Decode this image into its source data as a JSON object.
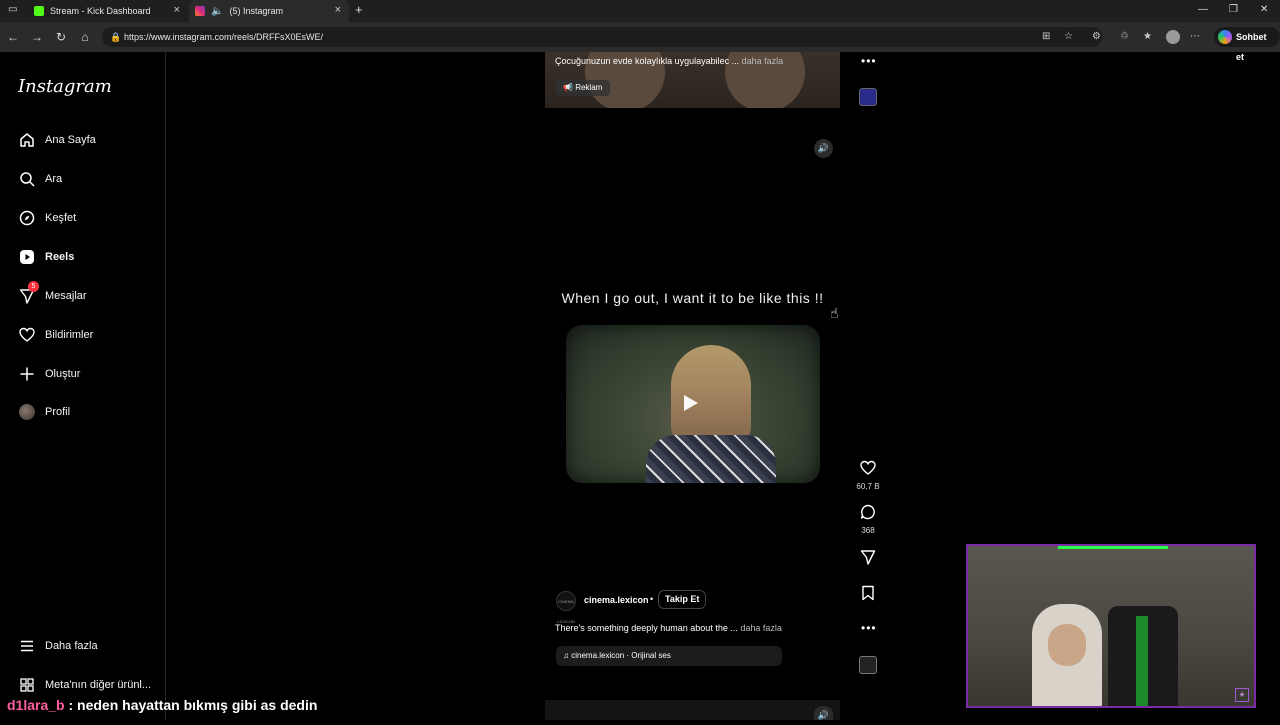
{
  "browser": {
    "tabs": [
      {
        "title": "Stream - Kick Dashboard",
        "icon": "kick-icon",
        "color": "#53fc18"
      },
      {
        "title": "(5) Instagram",
        "icon": "instagram-icon",
        "color": "#e1306c"
      }
    ],
    "new_tab": "+",
    "url": "https://www.instagram.com/reels/DRFFsX0EsWE/",
    "copilot_label": "Sohbet et"
  },
  "sidebar": {
    "logo": "Instagram",
    "items": [
      {
        "label": "Ana Sayfa",
        "icon": "home-icon"
      },
      {
        "label": "Ara",
        "icon": "search-icon"
      },
      {
        "label": "Keşfet",
        "icon": "compass-icon"
      },
      {
        "label": "Reels",
        "icon": "reels-icon",
        "active": true
      },
      {
        "label": "Mesajlar",
        "icon": "messenger-icon",
        "badge": "5"
      },
      {
        "label": "Bildirimler",
        "icon": "heart-icon"
      },
      {
        "label": "Oluştur",
        "icon": "plus-icon"
      },
      {
        "label": "Profil",
        "icon": "avatar"
      }
    ],
    "more": "Daha fazla",
    "meta": "Meta'nın diğer ürünl..."
  },
  "top_reel": {
    "caption": "Çocuğunuzun evde kolaylıkla uygulayabilec ...",
    "more": "daha fazla",
    "ad_label": "Reklam"
  },
  "reel": {
    "overlay_text": "When I go out, I want it to be like this !!",
    "likes": "60,7 B",
    "comments": "368",
    "username": "cinema.lexicon",
    "avatar_text": "CINEMA LEXICON",
    "follow": "Takip Et",
    "caption": "There's something deeply human about the ...",
    "more": "daha fazla",
    "audio": "cinema.lexicon · Orijinal ses"
  },
  "chat": {
    "user": "d1lara_b",
    "message": ": neden hayattan bıkmış gibi as dedin"
  }
}
